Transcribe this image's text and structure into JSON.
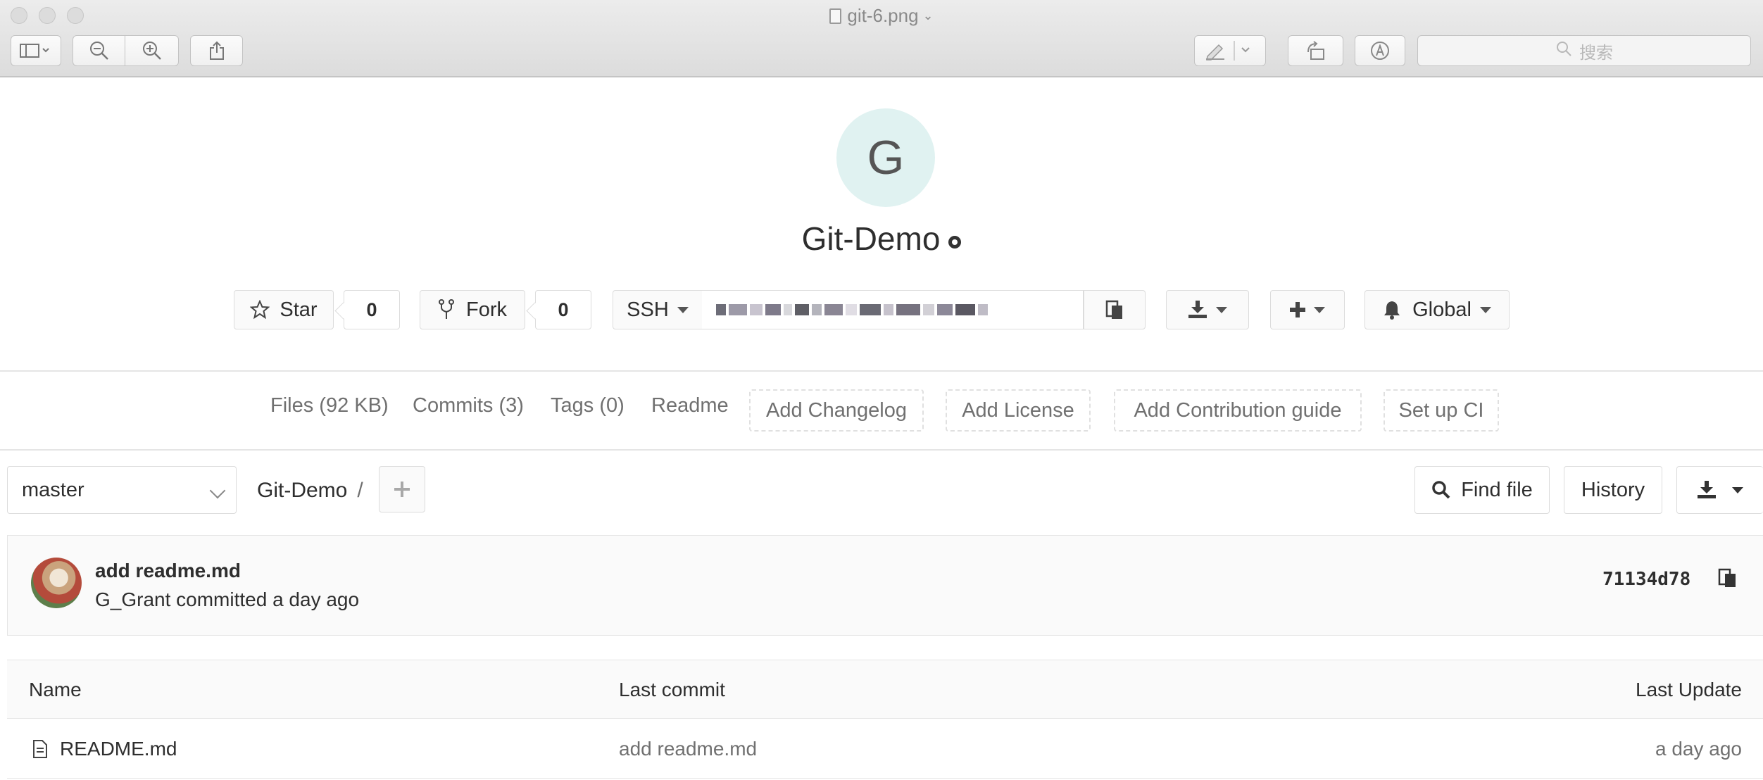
{
  "window": {
    "title": "git-6.png",
    "search_placeholder": "搜索"
  },
  "project": {
    "avatar_letter": "G",
    "name": "Git-Demo",
    "visibility_icon": "globe-icon",
    "star": {
      "label": "Star",
      "count": "0"
    },
    "fork": {
      "label": "Fork",
      "count": "0"
    },
    "clone": {
      "protocol": "SSH",
      "url_obscured": true
    },
    "notification": {
      "label": "Global"
    }
  },
  "nav": {
    "files": "Files (92 KB)",
    "commits": "Commits (3)",
    "tags": "Tags (0)",
    "readme": "Readme",
    "add_changelog": "Add Changelog",
    "add_license": "Add License",
    "add_contribution": "Add Contribution guide",
    "setup_ci": "Set up CI"
  },
  "repo": {
    "branch": "master",
    "path_root": "Git-Demo",
    "path_sep": "/",
    "find_file": "Find file",
    "history": "History"
  },
  "last_commit": {
    "message": "add readme.md",
    "author_line": "G_Grant committed a day ago",
    "sha": "71134d78"
  },
  "table": {
    "headers": {
      "name": "Name",
      "last_commit": "Last commit",
      "last_update": "Last Update"
    },
    "rows": [
      {
        "name": "README.md",
        "last_commit": "add readme.md",
        "last_update": "a day ago"
      }
    ]
  },
  "colors": {
    "avatar_bg": "#e0f2f1",
    "text": "#2e2e2e",
    "muted": "#707070",
    "border": "#dcdcdc"
  }
}
